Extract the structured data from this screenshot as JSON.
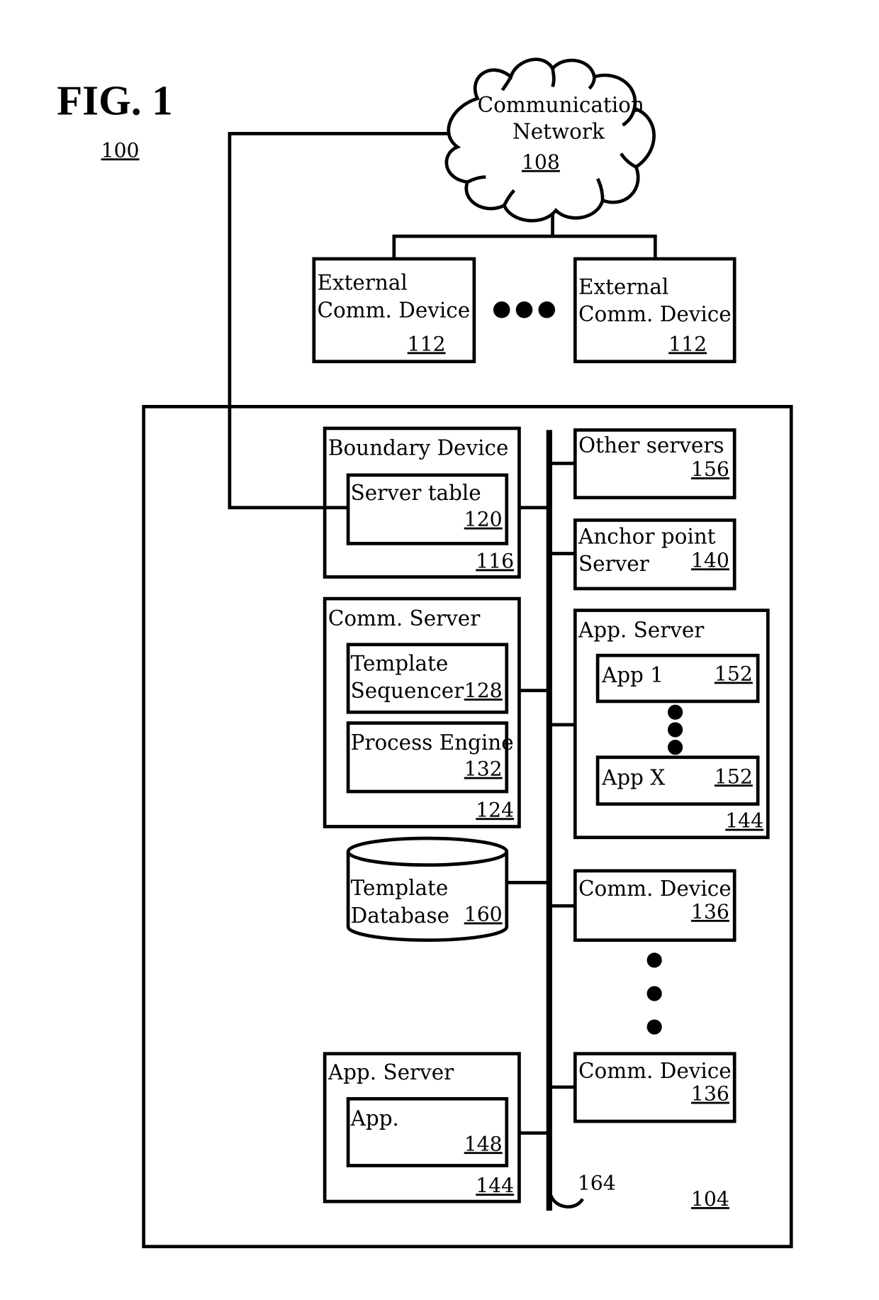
{
  "figure": {
    "title": "FIG. 1",
    "ref": "100"
  },
  "network": {
    "line1": "Communication",
    "line2": "Network",
    "ref": "108"
  },
  "external_devices": [
    {
      "line1": "External",
      "line2": "Comm. Device",
      "ref": "112"
    },
    {
      "line1": "External",
      "line2": "Comm. Device",
      "ref": "112"
    }
  ],
  "enterprise": {
    "ref": "104",
    "bus_ref": "164",
    "boundary_device": {
      "label": "Boundary Device",
      "ref": "116",
      "server_table": {
        "label": "Server table",
        "ref": "120"
      }
    },
    "other_servers": {
      "label": "Other servers",
      "ref": "156"
    },
    "anchor_point_server": {
      "line1": "Anchor point",
      "line2": "Server",
      "ref": "140"
    },
    "comm_server": {
      "label": "Comm. Server",
      "ref": "124",
      "template_sequencer": {
        "line1": "Template",
        "line2": "Sequencer",
        "ref": "128"
      },
      "process_engine": {
        "label": "Process Engine",
        "ref": "132"
      }
    },
    "app_server_right": {
      "label": "App. Server",
      "ref": "144",
      "apps": [
        {
          "label": "App 1",
          "ref": "152"
        },
        {
          "label": "App X",
          "ref": "152"
        }
      ]
    },
    "template_database": {
      "line1": "Template",
      "line2": "Database",
      "ref": "160"
    },
    "comm_devices": [
      {
        "label": "Comm. Device",
        "ref": "136"
      },
      {
        "label": "Comm. Device",
        "ref": "136"
      }
    ],
    "app_server_left": {
      "label": "App. Server",
      "ref": "144",
      "app": {
        "label": "App.",
        "ref": "148"
      }
    }
  }
}
